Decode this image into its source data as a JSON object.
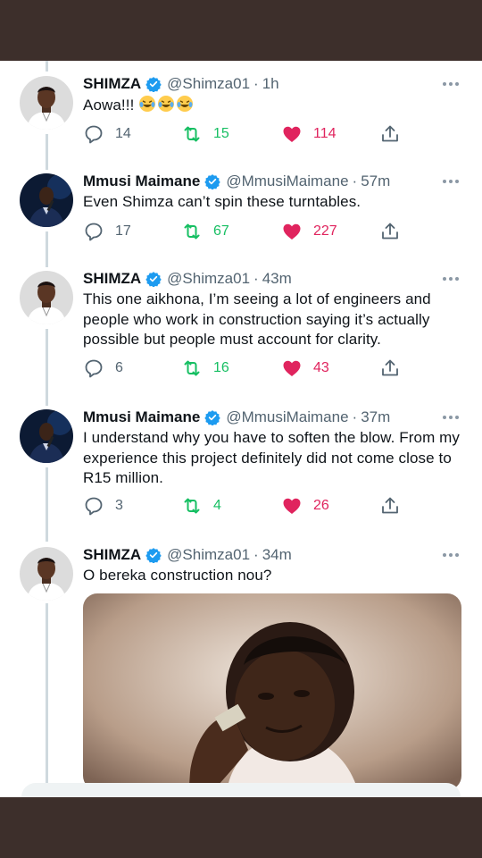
{
  "tweets": [
    {
      "name": "SHIMZA",
      "verified": true,
      "handle": "@Shimza01",
      "time": "1h",
      "text": "Aowa!!!",
      "emojis": [
        "face-with-tears-of-joy",
        "face-with-tears-of-joy",
        "face-with-tears-of-joy"
      ],
      "replies": "14",
      "retweets": "15",
      "likes": "114",
      "avatar": "shimza-avatar"
    },
    {
      "name": "Mmusi Maimane",
      "verified": true,
      "handle": "@MmusiMaimane",
      "time": "57m",
      "text": "Even Shimza can’t spin these turntables.",
      "replies": "17",
      "retweets": "67",
      "likes": "227",
      "avatar": "maimane-avatar"
    },
    {
      "name": "SHIMZA",
      "verified": true,
      "handle": "@Shimza01",
      "time": "43m",
      "text": "This one aikhona, I’m seeing a lot of engineers and people who work in construction saying it’s actually possible but people must account for clarity.",
      "replies": "6",
      "retweets": "16",
      "likes": "43",
      "avatar": "shimza-avatar"
    },
    {
      "name": "Mmusi Maimane",
      "verified": true,
      "handle": "@MmusiMaimane",
      "time": "37m",
      "text": "I understand why you have to soften the blow. From my experience this project definitely did not come close to R15 million.",
      "replies": "3",
      "retweets": "4",
      "likes": "26",
      "avatar": "maimane-avatar"
    },
    {
      "name": "SHIMZA",
      "verified": true,
      "handle": "@Shimza01",
      "time": "34m",
      "text": "O bereka construction nou?",
      "media": "gif-person-sipping",
      "avatar": "shimza-avatar"
    }
  ],
  "dot": "·",
  "colors": {
    "verified": "#1d9bf0",
    "retweet": "#17bf63",
    "like": "#e0245e",
    "muted": "#536471",
    "frame": "#3d2f2b"
  }
}
